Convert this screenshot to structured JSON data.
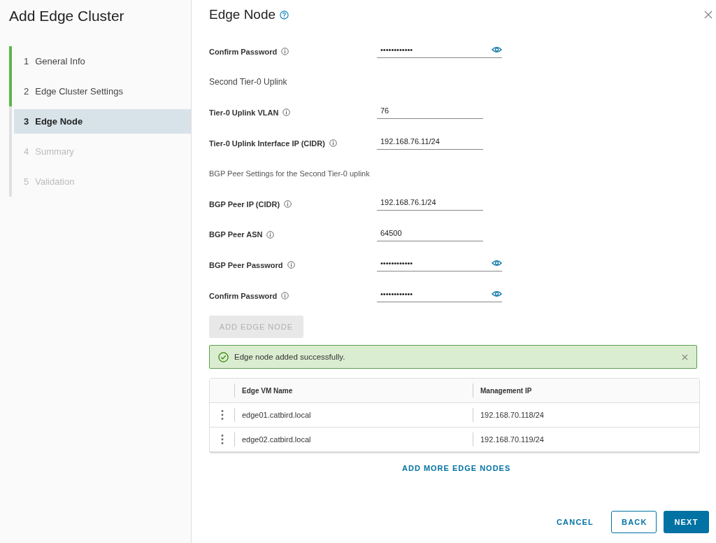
{
  "sidebar": {
    "title": "Add Edge Cluster",
    "steps": [
      {
        "number": "1",
        "label": "General Info",
        "completed": true,
        "selected": false,
        "disabled": false
      },
      {
        "number": "2",
        "label": "Edge Cluster Settings",
        "completed": true,
        "selected": false,
        "disabled": false
      },
      {
        "number": "3",
        "label": "Edge Node",
        "completed": false,
        "selected": true,
        "disabled": false
      },
      {
        "number": "4",
        "label": "Summary",
        "completed": false,
        "selected": false,
        "disabled": true
      },
      {
        "number": "5",
        "label": "Validation",
        "completed": false,
        "selected": false,
        "disabled": true
      }
    ]
  },
  "page": {
    "title": "Edge Node",
    "form": [
      {
        "kind": "password",
        "label": "Confirm Password",
        "value": "••••••••••••"
      },
      {
        "kind": "heading",
        "label": "Second Tier-0 Uplink"
      },
      {
        "kind": "field",
        "label": "Tier-0 Uplink VLAN",
        "value": "76"
      },
      {
        "kind": "field",
        "label": "Tier-0 Uplink Interface IP (CIDR)",
        "value": "192.168.76.11/24"
      },
      {
        "kind": "subheading",
        "label": "BGP Peer Settings for the Second Tier-0 uplink"
      },
      {
        "kind": "field",
        "label": "BGP Peer IP (CIDR)",
        "value": "192.168.76.1/24"
      },
      {
        "kind": "field",
        "label": "BGP Peer ASN",
        "value": "64500"
      },
      {
        "kind": "password",
        "label": "BGP Peer Password",
        "value": "••••••••••••"
      },
      {
        "kind": "password",
        "label": "Confirm Password",
        "value": "••••••••••••"
      }
    ],
    "add_button": {
      "label": "ADD EDGE NODE",
      "disabled": true
    },
    "alert": {
      "message": "Edge node added successfully."
    },
    "table": {
      "columns": [
        "Edge VM Name",
        "Management IP"
      ],
      "rows": [
        [
          "edge01.catbird.local",
          "192.168.70.118/24"
        ],
        [
          "edge02.catbird.local",
          "192.168.70.119/24"
        ]
      ]
    },
    "add_more": "ADD MORE EDGE NODES"
  },
  "footer": {
    "cancel": "CANCEL",
    "back": "BACK",
    "next": "NEXT"
  }
}
